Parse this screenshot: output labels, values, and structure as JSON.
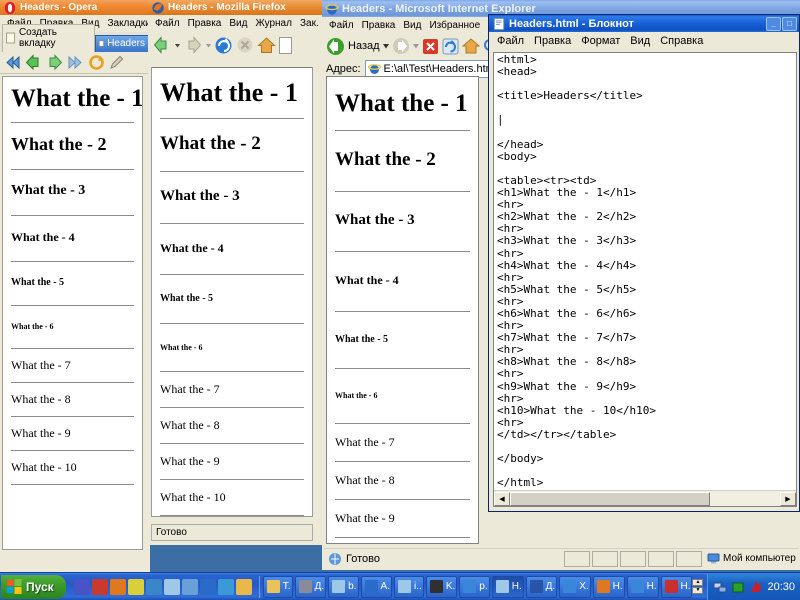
{
  "desktop": {
    "background_color": "#3a6ea5"
  },
  "windows": {
    "opera": {
      "title": "Headers - Opera",
      "icon": "opera-icon",
      "menus": [
        "Файл",
        "Правка",
        "Вид",
        "Закладки"
      ],
      "new_tab_label": "Создать вкладку",
      "tab_label": "Headers",
      "toolbar_icons": [
        "rewind-icon",
        "back-icon",
        "forward-icon",
        "fast-forward-icon",
        "reload-icon",
        "edit-icon"
      ]
    },
    "firefox": {
      "title": "Headers - Mozilla Firefox",
      "icon": "firefox-icon",
      "menus": [
        "Файл",
        "Правка",
        "Вид",
        "Журнал",
        "Зак."
      ],
      "toolbar_icons": [
        "back-icon",
        "forward-icon",
        "reload-icon",
        "stop-icon",
        "home-icon",
        "address-icon"
      ],
      "status_text": "Готово"
    },
    "ie": {
      "title": "Headers - Microsoft Internet Explorer",
      "icon": "ie-icon",
      "menus": [
        "Файл",
        "Правка",
        "Вид",
        "Избранное"
      ],
      "back_label": "Назад",
      "toolbar_icons": [
        "back-icon",
        "forward-icon",
        "stop-icon",
        "refresh-icon",
        "home-icon",
        "search-icon"
      ],
      "address_label": "Адрес:",
      "address_value": "E:\\al\\Test\\Headers.html",
      "status_text": "Готово",
      "zone_text": "Мой компьютер"
    },
    "notepad": {
      "title": "Headers.html - Блокнот",
      "icon": "notepad-icon",
      "menus": [
        "Файл",
        "Правка",
        "Формат",
        "Вид",
        "Справка"
      ],
      "buttons": [
        "minimize",
        "maximize"
      ],
      "source": "<html>\n<head>\n\n<title>Headers</title>\n\n|\n\n</head>\n<body>\n\n<table><tr><td>\n<h1>What the - 1</h1>\n<hr>\n<h2>What the - 2</h2>\n<hr>\n<h3>What the - 3</h3>\n<hr>\n<h4>What the - 4</h4>\n<hr>\n<h5>What the - 5</h5>\n<hr>\n<h6>What the - 6</h6>\n<hr>\n<h7>What the - 7</h7>\n<hr>\n<h8>What the - 8</h8>\n<hr>\n<h9>What the - 9</h9>\n<hr>\n<h10>What the - 10</h10>\n<hr>\n</td></tr></table>\n\n</body>\n\n</html>"
    }
  },
  "rendered_page": {
    "headings": [
      {
        "text": "What the - 1",
        "tag": "h1",
        "size_opera": 25,
        "size_ff": 26,
        "size_ie": 25,
        "bold": true
      },
      {
        "text": "What the - 2",
        "tag": "h2",
        "size_opera": 18,
        "size_ff": 19,
        "size_ie": 19,
        "bold": true
      },
      {
        "text": "What the - 3",
        "tag": "h3",
        "size_opera": 14,
        "size_ff": 15,
        "size_ie": 15,
        "bold": true
      },
      {
        "text": "What the - 4",
        "tag": "h4",
        "size_opera": 12,
        "size_ff": 12,
        "size_ie": 12,
        "bold": true
      },
      {
        "text": "What the - 5",
        "tag": "h5",
        "size_opera": 10,
        "size_ff": 10,
        "size_ie": 10,
        "bold": true
      },
      {
        "text": "What the - 6",
        "tag": "h6",
        "size_opera": 8,
        "size_ff": 8,
        "size_ie": 8,
        "bold": true
      },
      {
        "text": "What the - 7",
        "tag": "h7",
        "size_opera": 12,
        "size_ff": 12,
        "size_ie": 12,
        "bold": false
      },
      {
        "text": "What the - 8",
        "tag": "h8",
        "size_opera": 12,
        "size_ff": 12,
        "size_ie": 12,
        "bold": false
      },
      {
        "text": "What the - 9",
        "tag": "h9",
        "size_opera": 12,
        "size_ff": 12,
        "size_ie": 12,
        "bold": false
      },
      {
        "text": "What the - 10",
        "tag": "h10",
        "size_opera": 12,
        "size_ff": 12,
        "size_ie": 12,
        "bold": false
      }
    ]
  },
  "taskbar": {
    "start_label": "Пуск",
    "quick_launch": [
      {
        "name": "media-player-icon",
        "color": "#4a52c8"
      },
      {
        "name": "paint-icon",
        "color": "#c83a2e"
      },
      {
        "name": "firefox-icon",
        "color": "#e07820"
      },
      {
        "name": "save-icon",
        "color": "#d8cf3a"
      },
      {
        "name": "opera-icon",
        "color": "#3a86c8"
      },
      {
        "name": "notepad-icon",
        "color": "#9fc8e8"
      },
      {
        "name": "document-icon",
        "color": "#6aa0d8"
      },
      {
        "name": "ie-icon",
        "color": "#2a6ac8"
      },
      {
        "name": "internet-icon",
        "color": "#3a9ad8"
      },
      {
        "name": "folder-icon",
        "color": "#e8b84a"
      }
    ],
    "tasks": [
      {
        "label": "T.",
        "icon_color": "#e8c35a",
        "active": false
      },
      {
        "label": "Д.",
        "icon_color": "#8a8a9a",
        "active": false
      },
      {
        "label": "b.",
        "icon_color": "#9fc8e8",
        "active": false
      },
      {
        "label": "A.",
        "icon_color": "#2a6ac8",
        "active": false
      },
      {
        "label": "i..",
        "icon_color": "#9fc8e8",
        "active": false
      },
      {
        "label": "K.",
        "icon_color": "#303030",
        "active": false
      },
      {
        "label": "p.",
        "icon_color": "#3a86d8",
        "active": false
      },
      {
        "label": "H.",
        "icon_color": "#9fc8e8",
        "active": true
      },
      {
        "label": "Д.",
        "icon_color": "#2a54a8",
        "active": false
      },
      {
        "label": "X.",
        "icon_color": "#3a86d8",
        "active": false
      },
      {
        "label": "H.",
        "icon_color": "#e07820",
        "active": false
      },
      {
        "label": "H.",
        "icon_color": "#3a86d8",
        "active": false
      },
      {
        "label": "H.",
        "icon_color": "#c8302e",
        "active": false
      }
    ],
    "tray": {
      "icons": [
        {
          "name": "network-icon",
          "color": "#4a6ad8"
        },
        {
          "name": "battery-icon",
          "color": "#2aa02a"
        },
        {
          "name": "kaspersky-icon",
          "color": "#c8202a"
        }
      ],
      "clock": "20:30"
    }
  }
}
